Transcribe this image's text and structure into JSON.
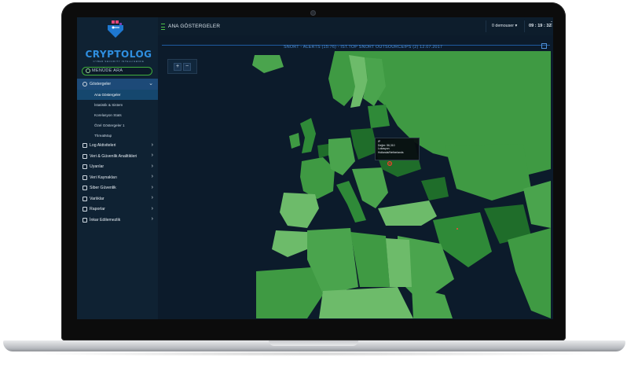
{
  "app": {
    "brand": "CRYPTOLOG",
    "brand_sub": "CYBER SECURITY INTELLIGENCE"
  },
  "sidebar": {
    "search_placeholder": "MENÜDE ARA",
    "items": [
      {
        "label": "Göstergeler",
        "active": true,
        "subitems": [
          {
            "label": "Ana Göstergeler",
            "active": true
          },
          {
            "label": "İstatistik & Sistem"
          },
          {
            "label": "Korelasyon Stats"
          },
          {
            "label": "Özel Göstergeler 1"
          },
          {
            "label": "ThreatMap"
          }
        ]
      },
      {
        "label": "Log Aktiviteleri"
      },
      {
        "label": "Veri & Güvenlik Analitikleri"
      },
      {
        "label": "Uyarılar"
      },
      {
        "label": "Veri Kaynakları"
      },
      {
        "label": "Siber Güvenlik"
      },
      {
        "label": "Varlıklar"
      },
      {
        "label": "Raporlar"
      },
      {
        "label": "İnkar Edilemezlik"
      }
    ]
  },
  "header": {
    "page_title": "ANA GÖSTERGELER",
    "user": "0 demouser ▾",
    "clock": "09 : 19 : 32",
    "more": "⋮"
  },
  "panel": {
    "title": "SNORT - ALERTS (15:76) - IST.TOP SNORT OUTSOURCEIPS (2) 12.07.2017",
    "zoom_in": "+",
    "zoom_out": "−"
  },
  "tooltip": {
    "line1": "IP",
    "line2": "Değer: 56,310",
    "line3": "Lokasyon",
    "line4": "Hollanda/Netherlands"
  },
  "colors": {
    "ocean": "#0c1b2b",
    "land_light": "#6dbb6a",
    "land_mid": "#3f9a43",
    "land_dark": "#1f6d2a",
    "accent": "#4ec349",
    "brand_blue": "#2f8fe0"
  },
  "icons": [
    "search-icon",
    "dashboard-icon",
    "log-icon",
    "shield-icon",
    "bell-icon",
    "database-icon",
    "globe-icon",
    "folder-icon",
    "report-icon",
    "check-icon",
    "chevron-right-icon",
    "chevron-down-icon",
    "menu-icon",
    "expand-icon"
  ]
}
